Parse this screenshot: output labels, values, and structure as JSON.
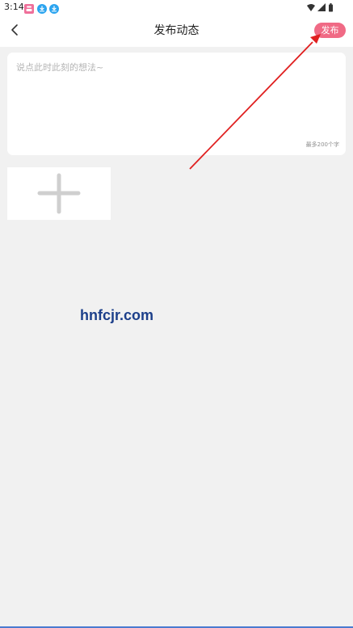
{
  "status_bar": {
    "time": "3:14",
    "app_icons": [
      "pink-app-icon",
      "download-icon",
      "download-icon"
    ],
    "right_icons": [
      "wifi-icon",
      "signal-icon",
      "battery-icon"
    ]
  },
  "header": {
    "back_icon": "chevron-left-icon",
    "title": "发布动态",
    "publish_label": "发布"
  },
  "editor": {
    "placeholder": "说点此时此刻的想法~",
    "value": "",
    "char_limit": "最多200个字"
  },
  "media": {
    "add_icon": "plus-icon"
  },
  "watermark": {
    "text": "hnfcjr.com"
  },
  "colors": {
    "accent": "#f06a85",
    "background": "#f1f1f1",
    "annotation_arrow": "#e02020",
    "watermark": "#1c3f8a"
  }
}
